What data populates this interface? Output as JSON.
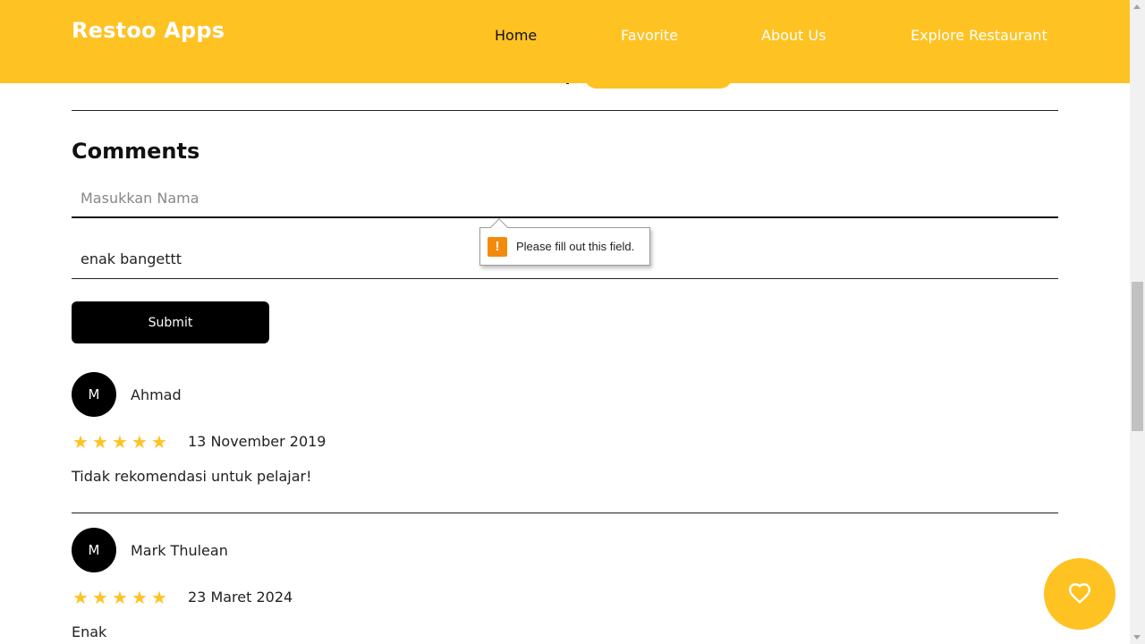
{
  "app": {
    "brand": "Restoo Apps"
  },
  "nav": {
    "home": "Home",
    "favorite": "Favorite",
    "about": "About Us",
    "explore": "Explore Restaurant"
  },
  "comments": {
    "title": "Comments",
    "name_placeholder": "Masukkan Nama",
    "name_value": "",
    "comment_value": "enak bangettt",
    "submit_label": "Submit",
    "validation_message": "Please fill out this field."
  },
  "reviews": [
    {
      "initial": "M",
      "name": "Ahmad",
      "rating": 5,
      "date": "13 November 2019",
      "text": "Tidak rekomendasi untuk pelajar!"
    },
    {
      "initial": "M",
      "name": "Mark Thulean",
      "rating": 5,
      "date": "23 Maret 2024",
      "text": "Enak"
    }
  ],
  "colors": {
    "accent": "#fec223",
    "dark": "#000000",
    "warning": "#f28b0c"
  },
  "icons": {
    "fab": "heart-outline-icon",
    "star": "star-icon",
    "warning": "exclamation-icon"
  }
}
